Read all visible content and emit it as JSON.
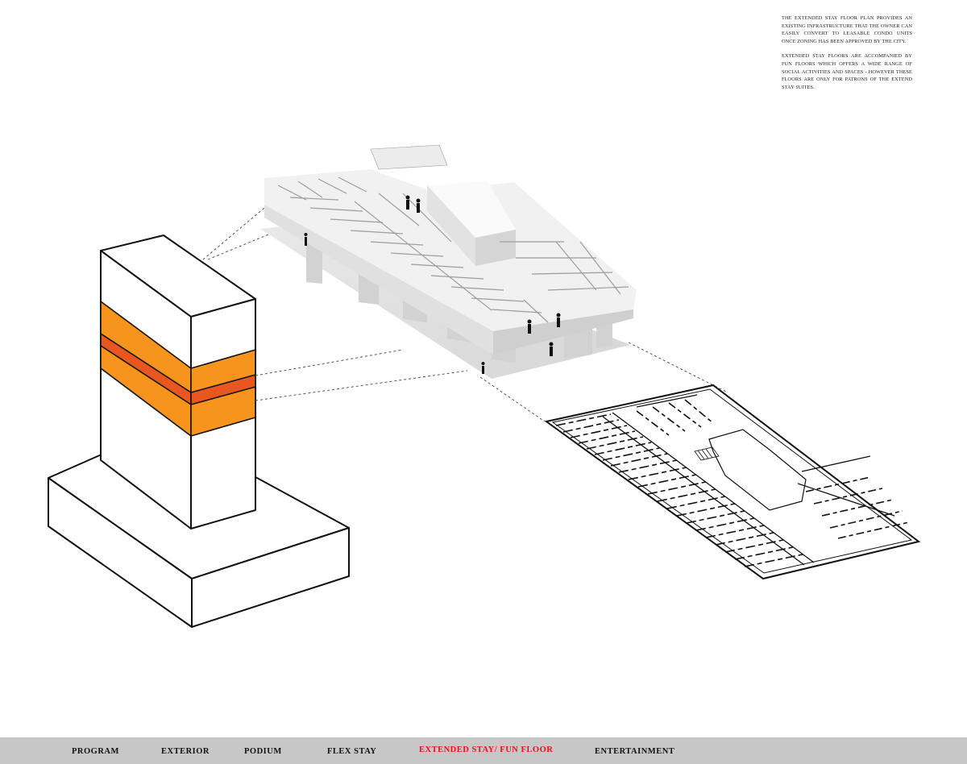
{
  "description": {
    "paragraph_1": "THE EXTENDED STAY FLOOR PLAN PROVIDES AN EXISTING INFRASTRUCTURE THAT THE OWNER CAN EASILY CONVERT TO LEASABLE CONDO UNITS ONCE ZONING HAS BEEN APPROVED BY THE CITY.",
    "paragraph_2": "EXTENDED STAY FLOORS ARE ACCOMPANIED BY FUN FLOORS WHICH OFFERS A WIDE RANGE OF SOCIAL ACTIVITIES AND SPACES - HOWEVER THESE FLOORS ARE ONLY FOR PATRONS OF THE EXTEND STAY SUITES."
  },
  "nav": {
    "items": [
      {
        "label": "PROGRAM",
        "active": false
      },
      {
        "label": "EXTERIOR",
        "active": false
      },
      {
        "label": "PODIUM",
        "active": false
      },
      {
        "label": "FLEX STAY",
        "active": false
      },
      {
        "label": "EXTENDED STAY/ FUN FLOOR",
        "active": true
      },
      {
        "label": "ENTERTAINMENT",
        "active": false
      }
    ],
    "active_color": "#e0161b"
  },
  "colors": {
    "highlight_floor": "#f7941d",
    "highlight_band": "#e8571f",
    "navbar_bg": "#c7c7c7",
    "model_light": "#f4f4f4",
    "model_mid": "#dcdcdc",
    "model_dark": "#c4c4c4"
  }
}
